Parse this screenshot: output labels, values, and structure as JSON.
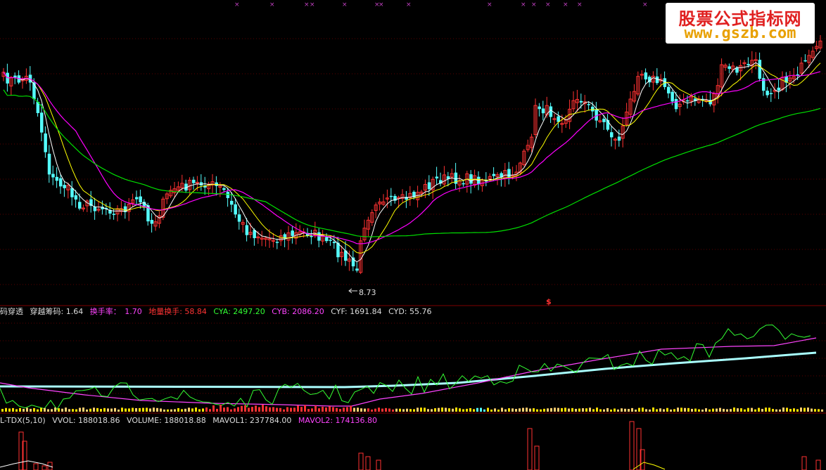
{
  "colors": {
    "up": "#ff3232",
    "down": "#54ffff",
    "ma5": "#ffffff",
    "ma10": "#ffff00",
    "ma20": "#ff00ff",
    "ma60": "#00e000",
    "cya": "#33ff33",
    "cyb": "#ff44ff",
    "cyf": "#aaffff",
    "separator": "#800000",
    "dotted_grid": "#5a0000"
  },
  "price_panel": {
    "low_marker": "8.73",
    "signal_mark": "$",
    "top_marker_glyph": "×"
  },
  "chip_panel": {
    "indicators": [
      {
        "text": "码穿透",
        "color": "#dddddd"
      },
      {
        "text": "穿越筹码: 1.64",
        "color": "#dddddd"
      },
      {
        "text": "换手率：",
        "color": "#ff44ff"
      },
      {
        "text": "1.70",
        "color": "#ff44ff"
      },
      {
        "text": "地量换手: 58.84",
        "color": "#ff3333"
      },
      {
        "text": "CYA: 2497.20",
        "color": "#33ff33"
      },
      {
        "text": "CYB: 2086.20",
        "color": "#ff44ff"
      },
      {
        "text": "CYF: 1691.84",
        "color": "#dddddd"
      },
      {
        "text": "CYD: 55.76",
        "color": "#dddddd"
      }
    ]
  },
  "volume_panel": {
    "indicators": [
      {
        "text": "L-TDX(5,10)",
        "color": "#dddddd"
      },
      {
        "text": "VVOL: 188018.86",
        "color": "#dddddd"
      },
      {
        "text": "VOLUME: 188018.88",
        "color": "#dddddd"
      },
      {
        "text": "MAVOL1: 237784.00",
        "color": "#dddddd"
      },
      {
        "text": "MAVOL2: 174136.80",
        "color": "#ff44ff"
      }
    ]
  },
  "watermark": {
    "line1": "股票公式指标网",
    "line2": "www.gszb.com"
  },
  "chart_data": [
    {
      "type": "candlestick",
      "title": "",
      "low_label": "8.73",
      "series": [
        {
          "name": "",
          "role": "ma5"
        },
        {
          "name": "",
          "role": "ma10"
        },
        {
          "name": "",
          "role": "ma20"
        },
        {
          "name": "",
          "role": "ma60"
        }
      ]
    },
    {
      "type": "line",
      "title": "",
      "series": [
        {
          "name": "CYA",
          "last": 2497.2
        },
        {
          "name": "CYB",
          "last": 2086.2
        },
        {
          "name": "CYF",
          "last": 1691.84
        }
      ]
    },
    {
      "type": "bar",
      "title": "",
      "series": [
        {
          "name": "VOLUME",
          "last": 188018.88
        },
        {
          "name": "MAVOL1",
          "last": 237784.0
        },
        {
          "name": "MAVOL2",
          "last": 174136.8
        }
      ]
    }
  ]
}
